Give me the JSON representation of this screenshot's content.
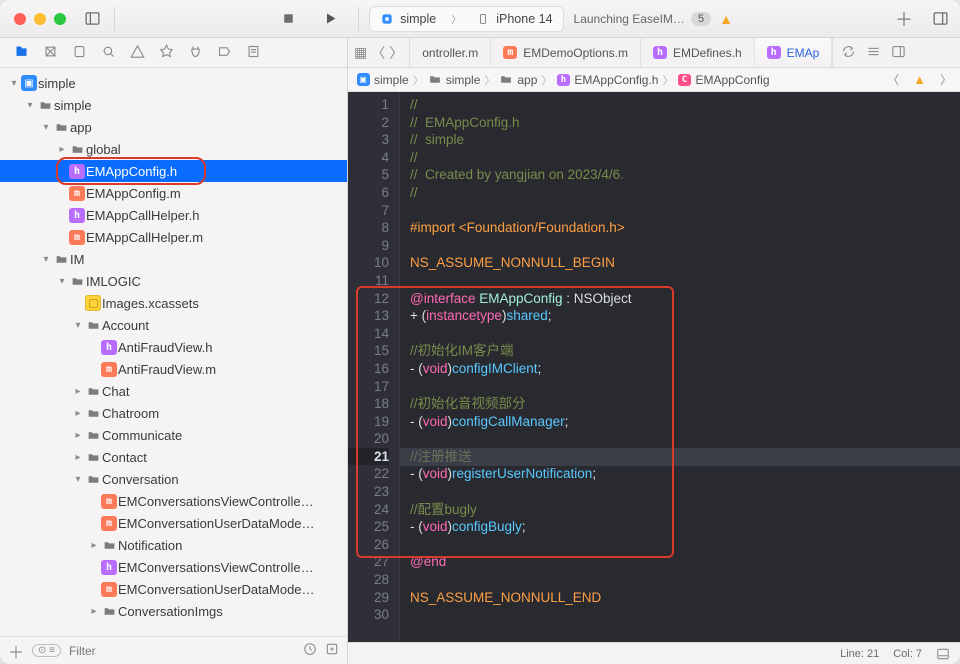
{
  "window": {
    "scheme": "simple",
    "destination": "iPhone 14",
    "status": "Launching EaseIM…",
    "status_badge": "5"
  },
  "navigator": {
    "project": "simple",
    "tree": {
      "root": "simple",
      "group_simple": "simple",
      "group_app": "app",
      "group_global": "global",
      "f_appconfig_h": "EMAppConfig.h",
      "f_appconfig_m": "EMAppConfig.m",
      "f_callhelper_h": "EMAppCallHelper.h",
      "f_callhelper_m": "EMAppCallHelper.m",
      "group_im": "IM",
      "group_imlogic": "IMLOGIC",
      "f_images": "Images.xcassets",
      "group_account": "Account",
      "f_antifraud_h": "AntiFraudView.h",
      "f_antifraud_m": "AntiFraudView.m",
      "group_chat": "Chat",
      "group_chatroom": "Chatroom",
      "group_communicate": "Communicate",
      "group_contact": "Contact",
      "group_conversation": "Conversation",
      "f_convvc_m": "EMConversationsViewControlle…",
      "f_convdm_m": "EMConversationUserDataMode…",
      "group_notification": "Notification",
      "f_convvc_h": "EMConversationsViewControlle…",
      "f_convdm_m2": "EMConversationUserDataMode…",
      "group_convimgs": "ConversationImgs"
    },
    "filter_placeholder": "Filter"
  },
  "editor": {
    "tabs": {
      "t0": "ontroller.m",
      "t1": "EMDemoOptions.m",
      "t2": "EMDefines.h",
      "t3": "EMAp"
    },
    "jumpbar": {
      "p0": "simple",
      "p1": "simple",
      "p2": "app",
      "p3": "EMAppConfig.h",
      "p4": "EMAppConfig"
    },
    "code": {
      "l1": "//",
      "l2": "//  EMAppConfig.h",
      "l3": "//  simple",
      "l4": "//",
      "l5": "//  Created by yangjian on 2023/4/6.",
      "l6": "//",
      "l8_pre": "#import ",
      "l8_lt": "<",
      "l8_lib": "Foundation/Foundation.h",
      "l8_gt": ">",
      "l10": "NS_ASSUME_NONNULL_BEGIN",
      "l12_iface": "@interface",
      "l12_cls": " EMAppConfig",
      "l12_rest": " : NSObject",
      "l13_plus": "+ (",
      "l13_type": "instancetype",
      "l13_paren": ")",
      "l13_m": "shared",
      "l13_semi": ";",
      "l15": "//初始化IM客户端",
      "l16_pre": "- (",
      "l16_void": "void",
      "l16_paren": ")",
      "l16_m": "configIMClient",
      "l16_semi": ";",
      "l18": "//初始化音视频部分",
      "l19_pre": "- (",
      "l19_void": "void",
      "l19_paren": ")",
      "l19_m": "configCallManager",
      "l19_semi": ";",
      "l21": "//注册推送",
      "l22_pre": "- (",
      "l22_void": "void",
      "l22_paren": ")",
      "l22_m": "registerUserNotification",
      "l22_semi": ";",
      "l24": "//配置bugly",
      "l25_pre": "- (",
      "l25_void": "void",
      "l25_paren": ")",
      "l25_m": "configBugly",
      "l25_semi": ";",
      "l27": "@end",
      "l29": "NS_ASSUME_NONNULL_END"
    }
  },
  "statusbar": {
    "line": "Line: 21",
    "col": "Col: 7"
  }
}
